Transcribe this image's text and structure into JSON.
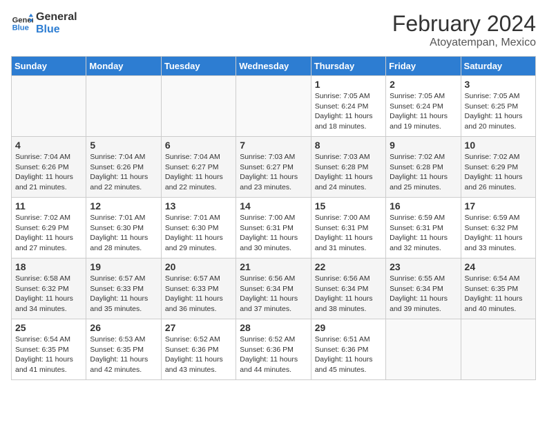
{
  "logo": {
    "line1": "General",
    "line2": "Blue"
  },
  "title": "February 2024",
  "subtitle": "Atoyatempan, Mexico",
  "headers": [
    "Sunday",
    "Monday",
    "Tuesday",
    "Wednesday",
    "Thursday",
    "Friday",
    "Saturday"
  ],
  "weeks": [
    [
      {
        "day": "",
        "sunrise": "",
        "sunset": "",
        "daylight": ""
      },
      {
        "day": "",
        "sunrise": "",
        "sunset": "",
        "daylight": ""
      },
      {
        "day": "",
        "sunrise": "",
        "sunset": "",
        "daylight": ""
      },
      {
        "day": "",
        "sunrise": "",
        "sunset": "",
        "daylight": ""
      },
      {
        "day": "1",
        "sunrise": "Sunrise: 7:05 AM",
        "sunset": "Sunset: 6:24 PM",
        "daylight": "Daylight: 11 hours and 18 minutes."
      },
      {
        "day": "2",
        "sunrise": "Sunrise: 7:05 AM",
        "sunset": "Sunset: 6:24 PM",
        "daylight": "Daylight: 11 hours and 19 minutes."
      },
      {
        "day": "3",
        "sunrise": "Sunrise: 7:05 AM",
        "sunset": "Sunset: 6:25 PM",
        "daylight": "Daylight: 11 hours and 20 minutes."
      }
    ],
    [
      {
        "day": "4",
        "sunrise": "Sunrise: 7:04 AM",
        "sunset": "Sunset: 6:26 PM",
        "daylight": "Daylight: 11 hours and 21 minutes."
      },
      {
        "day": "5",
        "sunrise": "Sunrise: 7:04 AM",
        "sunset": "Sunset: 6:26 PM",
        "daylight": "Daylight: 11 hours and 22 minutes."
      },
      {
        "day": "6",
        "sunrise": "Sunrise: 7:04 AM",
        "sunset": "Sunset: 6:27 PM",
        "daylight": "Daylight: 11 hours and 22 minutes."
      },
      {
        "day": "7",
        "sunrise": "Sunrise: 7:03 AM",
        "sunset": "Sunset: 6:27 PM",
        "daylight": "Daylight: 11 hours and 23 minutes."
      },
      {
        "day": "8",
        "sunrise": "Sunrise: 7:03 AM",
        "sunset": "Sunset: 6:28 PM",
        "daylight": "Daylight: 11 hours and 24 minutes."
      },
      {
        "day": "9",
        "sunrise": "Sunrise: 7:02 AM",
        "sunset": "Sunset: 6:28 PM",
        "daylight": "Daylight: 11 hours and 25 minutes."
      },
      {
        "day": "10",
        "sunrise": "Sunrise: 7:02 AM",
        "sunset": "Sunset: 6:29 PM",
        "daylight": "Daylight: 11 hours and 26 minutes."
      }
    ],
    [
      {
        "day": "11",
        "sunrise": "Sunrise: 7:02 AM",
        "sunset": "Sunset: 6:29 PM",
        "daylight": "Daylight: 11 hours and 27 minutes."
      },
      {
        "day": "12",
        "sunrise": "Sunrise: 7:01 AM",
        "sunset": "Sunset: 6:30 PM",
        "daylight": "Daylight: 11 hours and 28 minutes."
      },
      {
        "day": "13",
        "sunrise": "Sunrise: 7:01 AM",
        "sunset": "Sunset: 6:30 PM",
        "daylight": "Daylight: 11 hours and 29 minutes."
      },
      {
        "day": "14",
        "sunrise": "Sunrise: 7:00 AM",
        "sunset": "Sunset: 6:31 PM",
        "daylight": "Daylight: 11 hours and 30 minutes."
      },
      {
        "day": "15",
        "sunrise": "Sunrise: 7:00 AM",
        "sunset": "Sunset: 6:31 PM",
        "daylight": "Daylight: 11 hours and 31 minutes."
      },
      {
        "day": "16",
        "sunrise": "Sunrise: 6:59 AM",
        "sunset": "Sunset: 6:31 PM",
        "daylight": "Daylight: 11 hours and 32 minutes."
      },
      {
        "day": "17",
        "sunrise": "Sunrise: 6:59 AM",
        "sunset": "Sunset: 6:32 PM",
        "daylight": "Daylight: 11 hours and 33 minutes."
      }
    ],
    [
      {
        "day": "18",
        "sunrise": "Sunrise: 6:58 AM",
        "sunset": "Sunset: 6:32 PM",
        "daylight": "Daylight: 11 hours and 34 minutes."
      },
      {
        "day": "19",
        "sunrise": "Sunrise: 6:57 AM",
        "sunset": "Sunset: 6:33 PM",
        "daylight": "Daylight: 11 hours and 35 minutes."
      },
      {
        "day": "20",
        "sunrise": "Sunrise: 6:57 AM",
        "sunset": "Sunset: 6:33 PM",
        "daylight": "Daylight: 11 hours and 36 minutes."
      },
      {
        "day": "21",
        "sunrise": "Sunrise: 6:56 AM",
        "sunset": "Sunset: 6:34 PM",
        "daylight": "Daylight: 11 hours and 37 minutes."
      },
      {
        "day": "22",
        "sunrise": "Sunrise: 6:56 AM",
        "sunset": "Sunset: 6:34 PM",
        "daylight": "Daylight: 11 hours and 38 minutes."
      },
      {
        "day": "23",
        "sunrise": "Sunrise: 6:55 AM",
        "sunset": "Sunset: 6:34 PM",
        "daylight": "Daylight: 11 hours and 39 minutes."
      },
      {
        "day": "24",
        "sunrise": "Sunrise: 6:54 AM",
        "sunset": "Sunset: 6:35 PM",
        "daylight": "Daylight: 11 hours and 40 minutes."
      }
    ],
    [
      {
        "day": "25",
        "sunrise": "Sunrise: 6:54 AM",
        "sunset": "Sunset: 6:35 PM",
        "daylight": "Daylight: 11 hours and 41 minutes."
      },
      {
        "day": "26",
        "sunrise": "Sunrise: 6:53 AM",
        "sunset": "Sunset: 6:35 PM",
        "daylight": "Daylight: 11 hours and 42 minutes."
      },
      {
        "day": "27",
        "sunrise": "Sunrise: 6:52 AM",
        "sunset": "Sunset: 6:36 PM",
        "daylight": "Daylight: 11 hours and 43 minutes."
      },
      {
        "day": "28",
        "sunrise": "Sunrise: 6:52 AM",
        "sunset": "Sunset: 6:36 PM",
        "daylight": "Daylight: 11 hours and 44 minutes."
      },
      {
        "day": "29",
        "sunrise": "Sunrise: 6:51 AM",
        "sunset": "Sunset: 6:36 PM",
        "daylight": "Daylight: 11 hours and 45 minutes."
      },
      {
        "day": "",
        "sunrise": "",
        "sunset": "",
        "daylight": ""
      },
      {
        "day": "",
        "sunrise": "",
        "sunset": "",
        "daylight": ""
      }
    ]
  ]
}
